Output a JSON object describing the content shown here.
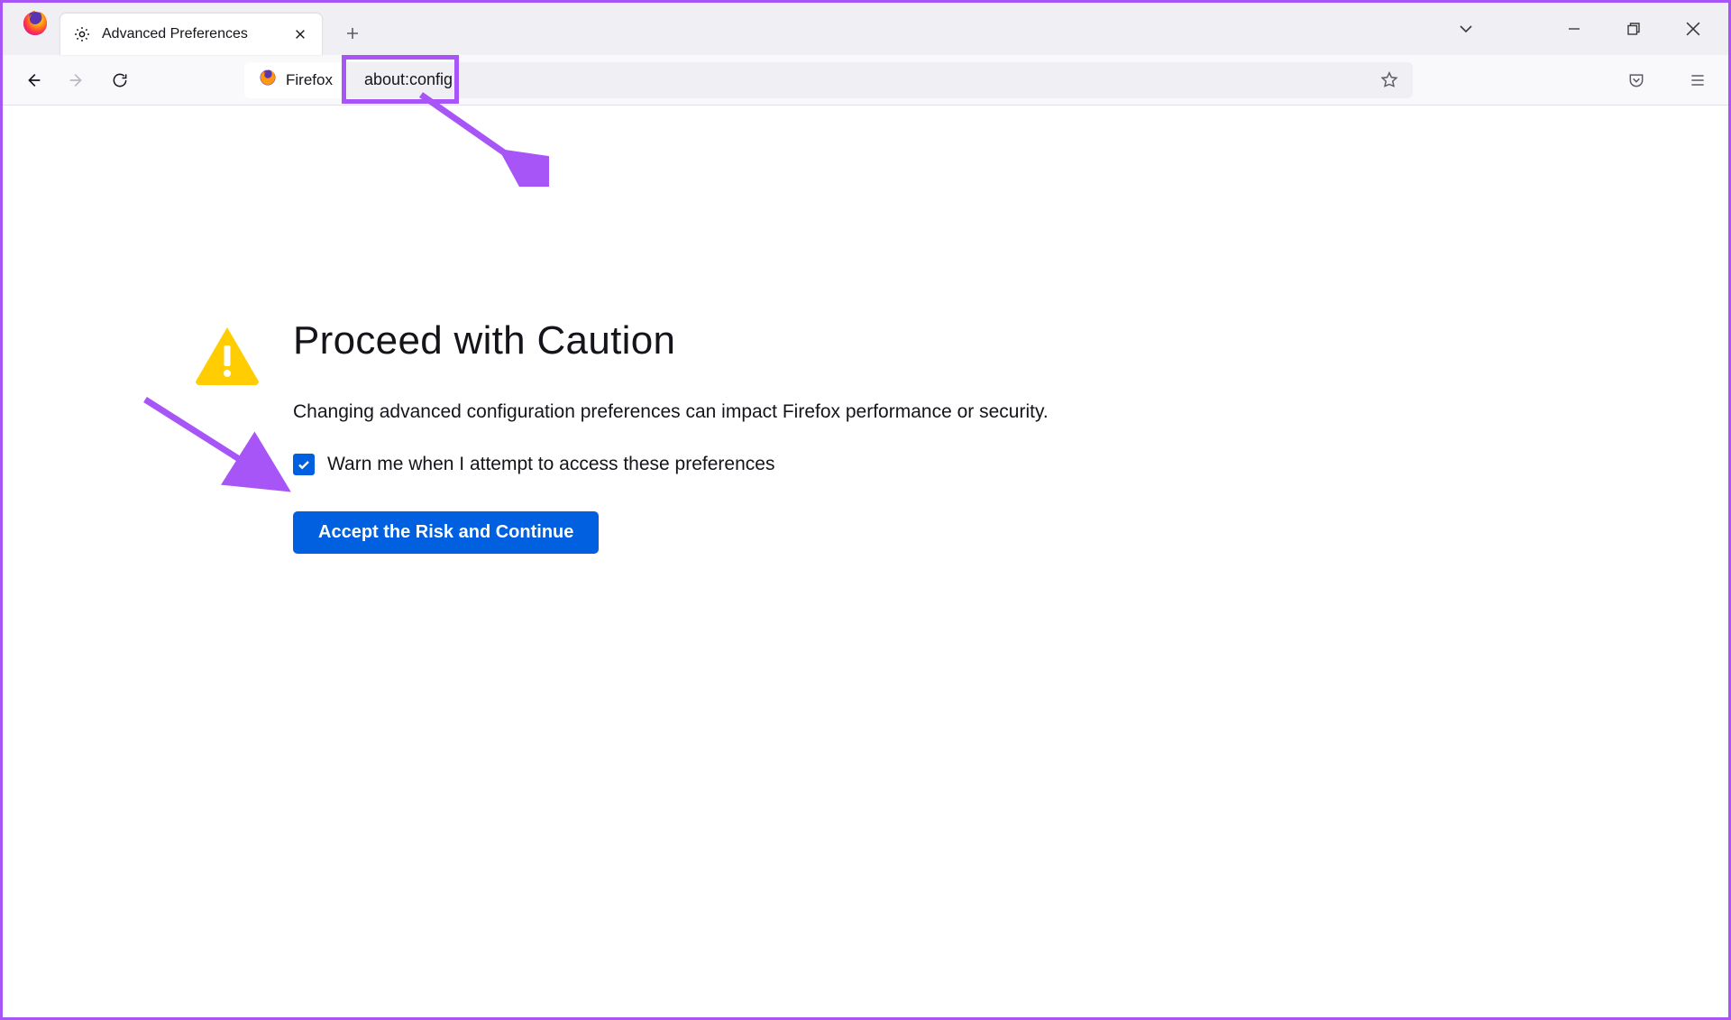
{
  "tab": {
    "title": "Advanced Preferences"
  },
  "urlbar": {
    "identity_label": "Firefox",
    "url": "about:config"
  },
  "warning": {
    "title": "Proceed with Caution",
    "description": "Changing advanced configuration preferences can impact Firefox performance or security.",
    "checkbox_label": "Warn me when I attempt to access these preferences",
    "accept_button": "Accept the Risk and Continue"
  }
}
